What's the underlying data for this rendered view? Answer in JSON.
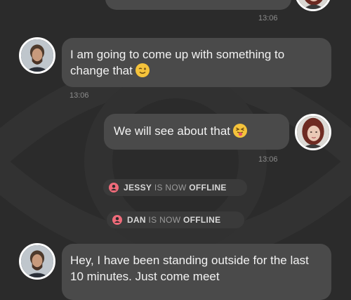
{
  "messages": [
    {
      "id": "m0",
      "side": "right",
      "text": "",
      "time": "13:06"
    },
    {
      "id": "m1",
      "side": "left",
      "text": "I am going to come up with something to change that",
      "emoji": "winking-face",
      "time": "13:06"
    },
    {
      "id": "m2",
      "side": "right",
      "text": "We will see about that",
      "emoji": "tongue-winking-face",
      "time": "13:06"
    },
    {
      "id": "m3",
      "side": "left",
      "text": "Hey, I have been standing outside for the last 10 minutes. Just come meet"
    }
  ],
  "statuses": [
    {
      "name": "JESSY",
      "middle": "IS NOW",
      "state": "OFFLINE"
    },
    {
      "name": "DAN",
      "middle": "IS NOW",
      "state": "OFFLINE"
    }
  ],
  "colors": {
    "background": "#2b2b2b",
    "bubble": "#4a4a4a",
    "status_pill": "#3a3a3a",
    "user_icon": "#ef6b7a"
  }
}
